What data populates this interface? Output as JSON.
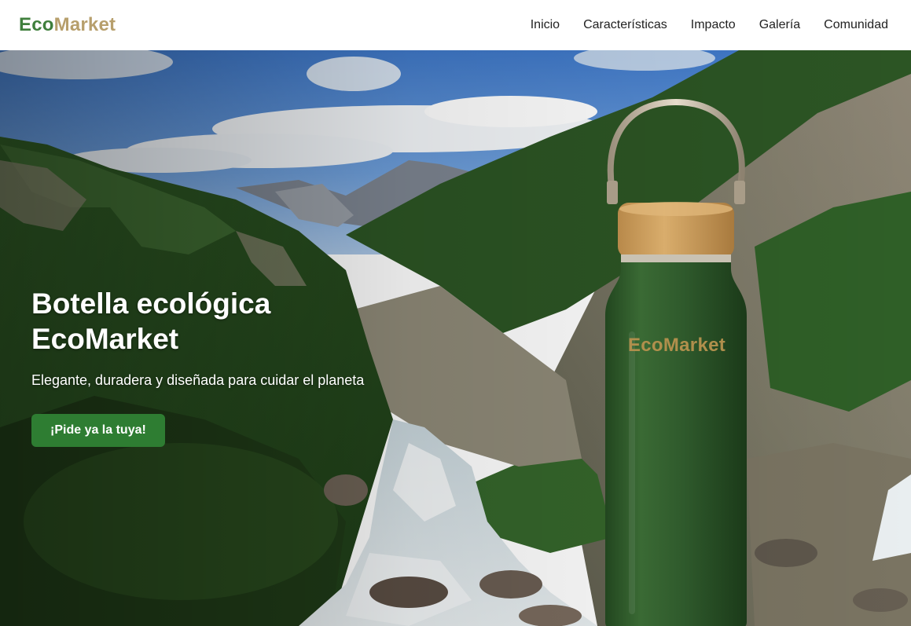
{
  "brand": {
    "logo_part1": "Eco",
    "logo_part2": "Market",
    "color_primary": "#3f7f3c",
    "color_accent": "#b79f6c"
  },
  "nav": {
    "items": [
      {
        "label": "Inicio"
      },
      {
        "label": "Características"
      },
      {
        "label": "Impacto"
      },
      {
        "label": "Galería"
      },
      {
        "label": "Comunidad"
      }
    ]
  },
  "hero": {
    "title_line1": "Botella ecológica",
    "title_line2": "EcoMarket",
    "subtitle": "Elegante, duradera y diseñada para cuidar el planeta",
    "cta_label": "¡Pide ya la tuya!",
    "cta_color": "#2e7d32",
    "bottle_logo": "EcoMarket",
    "bottle_color": "#2f5a2c"
  }
}
